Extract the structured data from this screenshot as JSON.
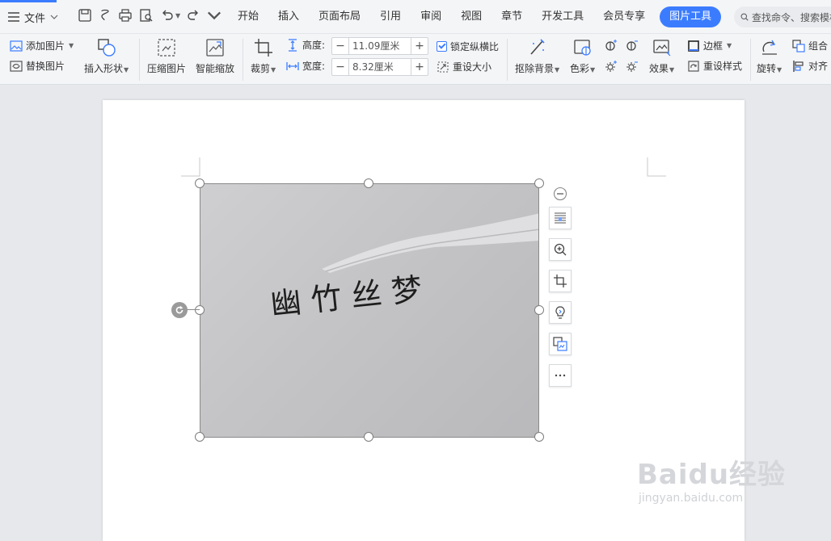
{
  "topbar": {
    "file_label": "文件",
    "tabs": [
      {
        "label": "开始"
      },
      {
        "label": "插入"
      },
      {
        "label": "页面布局"
      },
      {
        "label": "引用"
      },
      {
        "label": "审阅"
      },
      {
        "label": "视图"
      },
      {
        "label": "章节"
      },
      {
        "label": "开发工具"
      },
      {
        "label": "会员专享"
      },
      {
        "label": "图片工具"
      }
    ],
    "active_tab": "图片工具",
    "search_placeholder": "查找命令、搜索模板"
  },
  "ribbon": {
    "add_picture": "添加图片",
    "replace_picture": "替换图片",
    "insert_shape": "插入形状",
    "compress_picture": "压缩图片",
    "smart_scale": "智能缩放",
    "crop": "裁剪",
    "height_label": "高度:",
    "height_value": "11.09厘米",
    "width_label": "宽度:",
    "width_value": "8.32厘米",
    "lock_ratio": "锁定纵横比",
    "reset_size": "重设大小",
    "remove_bg": "抠除背景",
    "color": "色彩",
    "effects": "效果",
    "border": "边框",
    "reset_style": "重设样式",
    "rotate": "旋转",
    "group": "组合",
    "align": "对齐"
  },
  "document": {
    "handwriting_text": "幽竹丝梦"
  },
  "watermark": {
    "logo": "Baidu经验",
    "url": "jingyan.baidu.com"
  },
  "colors": {
    "accent": "#3b7cff",
    "ribbon_bg": "#f4f5f7",
    "canvas_bg": "#e6e8eb"
  }
}
